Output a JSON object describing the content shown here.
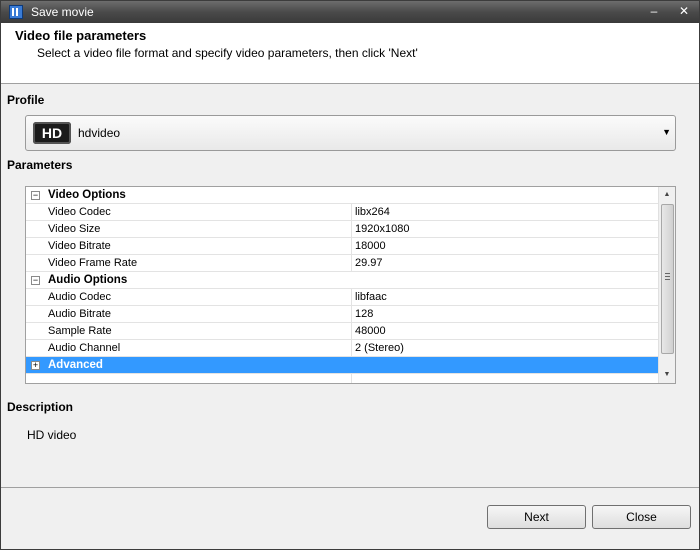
{
  "window": {
    "title": "Save movie"
  },
  "header": {
    "title": "Video file parameters",
    "subtitle": "Select a video file format and specify video parameters, then click 'Next'"
  },
  "profile": {
    "section_label": "Profile",
    "badge": "HD",
    "selected": "hdvideo"
  },
  "parameters": {
    "section_label": "Parameters",
    "rows": [
      {
        "name": "Video Options",
        "value": "",
        "type": "category",
        "toggle": "⊟"
      },
      {
        "name": "Video Codec",
        "value": "libx264",
        "type": "item"
      },
      {
        "name": "Video Size",
        "value": "1920x1080",
        "type": "item"
      },
      {
        "name": "Video Bitrate",
        "value": "18000",
        "type": "item"
      },
      {
        "name": "Video Frame Rate",
        "value": "29.97",
        "type": "item"
      },
      {
        "name": "Audio Options",
        "value": "",
        "type": "category",
        "toggle": "⊟"
      },
      {
        "name": "Audio Codec",
        "value": "libfaac",
        "type": "item"
      },
      {
        "name": "Audio Bitrate",
        "value": "128",
        "type": "item"
      },
      {
        "name": "Sample Rate",
        "value": "48000",
        "type": "item"
      },
      {
        "name": "Audio Channel",
        "value": "2 (Stereo)",
        "type": "item"
      },
      {
        "name": "Advanced",
        "value": "",
        "type": "category",
        "toggle": "⊞",
        "selected": true
      }
    ]
  },
  "description": {
    "section_label": "Description",
    "text": "HD video"
  },
  "buttons": {
    "next": "Next",
    "close": "Close"
  }
}
